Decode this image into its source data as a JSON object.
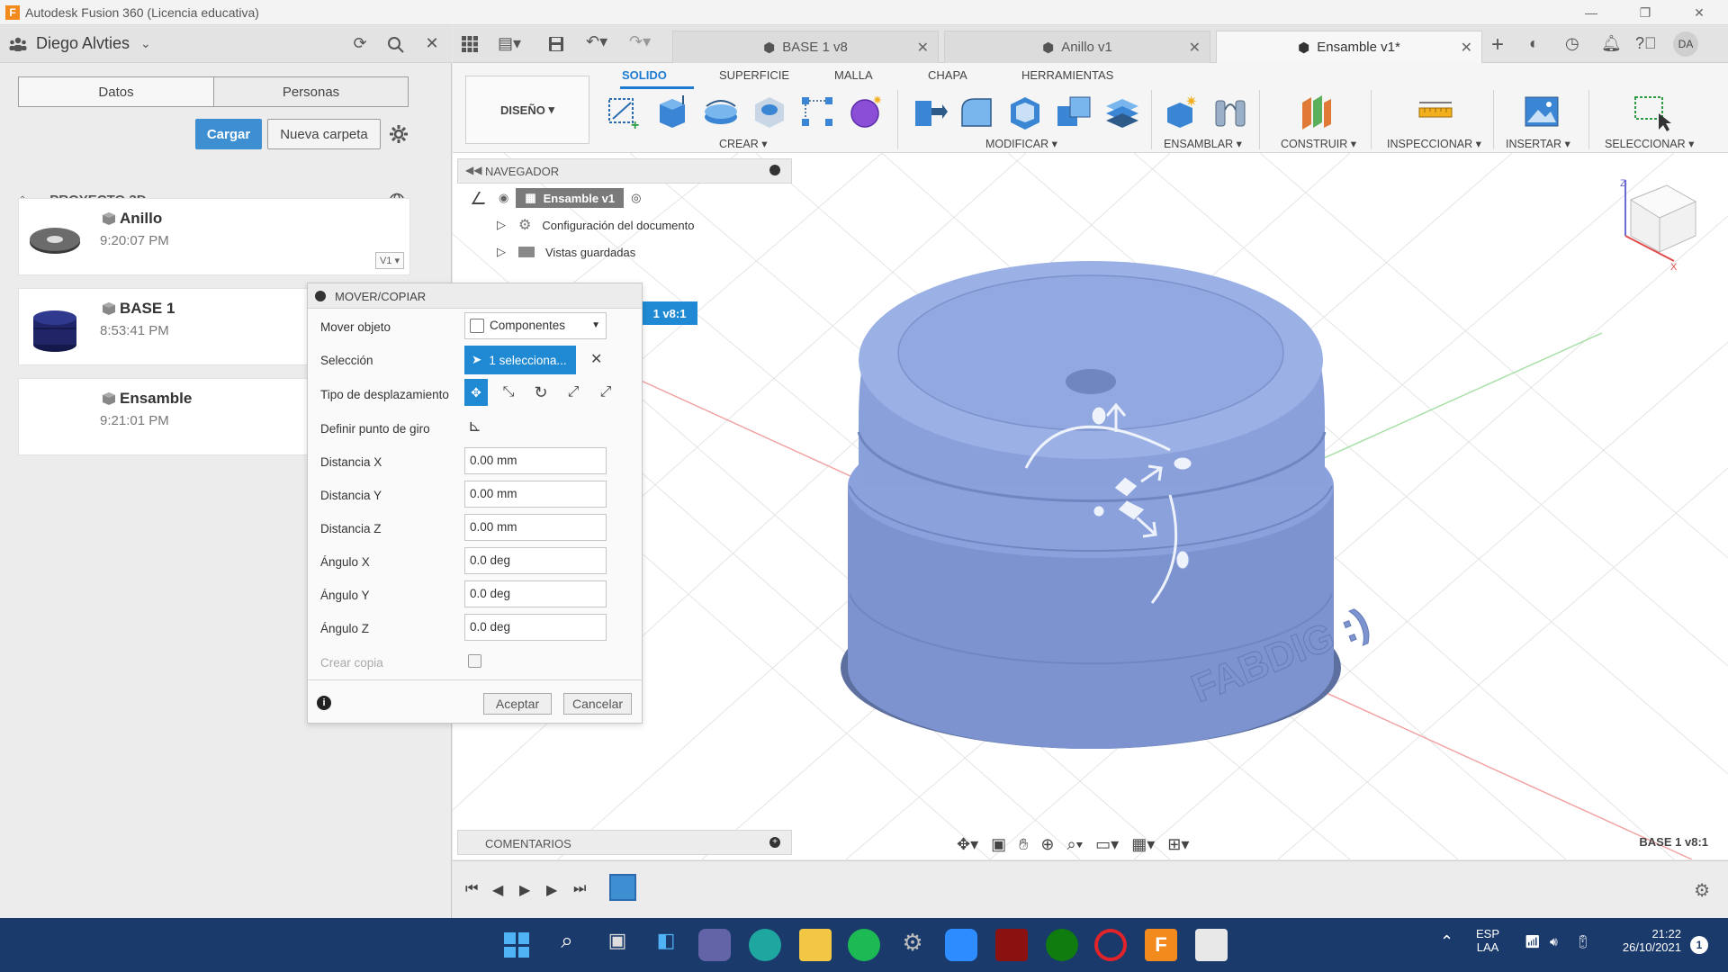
{
  "window": {
    "title": "Autodesk Fusion 360 (Licencia educativa)",
    "app_logo": "F"
  },
  "datapanel": {
    "user": "Diego Alvties",
    "tabs": [
      "Datos",
      "Personas"
    ],
    "upload_label": "Cargar",
    "new_folder_label": "Nueva carpeta",
    "project": "PROYECTO 3D",
    "items": [
      {
        "name": "Anillo",
        "time": "9:20:07 PM",
        "version": "V1"
      },
      {
        "name": "BASE 1",
        "time": "8:53:41 PM"
      },
      {
        "name": "Ensamble",
        "time": "9:21:01 PM"
      }
    ]
  },
  "doc_tabs": [
    {
      "label": "BASE 1 v8",
      "active": false
    },
    {
      "label": "Anillo v1",
      "active": false
    },
    {
      "label": "Ensamble v1*",
      "active": true
    }
  ],
  "user_initials": "DA",
  "toolbar": {
    "workspace": "DISEÑO",
    "ws_tabs": [
      "SOLIDO",
      "SUPERFICIE",
      "MALLA",
      "CHAPA",
      "HERRAMIENTAS"
    ],
    "groups": [
      "CREAR",
      "MODIFICAR",
      "ENSAMBLAR",
      "CONSTRUIR",
      "INSPECCIONAR",
      "INSERTAR",
      "SELECCIONAR"
    ]
  },
  "navigator": {
    "title": "NAVEGADOR",
    "root": "Ensamble v1",
    "rows": [
      "Configuración del documento",
      "Vistas guardadas"
    ]
  },
  "component_tag": "1 v8:1",
  "dialog": {
    "title": "MOVER/COPIAR",
    "move_object_label": "Mover objeto",
    "move_object_value": "Componentes",
    "selection_label": "Selección",
    "selection_value": "1 selecciona...",
    "move_type_label": "Tipo de desplazamiento",
    "pivot_label": "Definir punto de giro",
    "fields": [
      {
        "label": "Distancia X",
        "value": "0.00 mm"
      },
      {
        "label": "Distancia Y",
        "value": "0.00 mm"
      },
      {
        "label": "Distancia Z",
        "value": "0.00 mm"
      },
      {
        "label": "Ángulo X",
        "value": "0.0 deg"
      },
      {
        "label": "Ángulo Y",
        "value": "0.0 deg"
      },
      {
        "label": "Ángulo Z",
        "value": "0.0 deg"
      }
    ],
    "copy_label": "Crear copia",
    "ok_label": "Aceptar",
    "cancel_label": "Cancelar"
  },
  "model_text": "FABDIG :)",
  "comments_label": "COMENTARIOS",
  "status_label": "BASE 1 v8:1",
  "taskbar": {
    "lang1": "ESP",
    "lang2": "LAA",
    "time": "21:22",
    "date": "26/10/2021",
    "notif": "1"
  }
}
